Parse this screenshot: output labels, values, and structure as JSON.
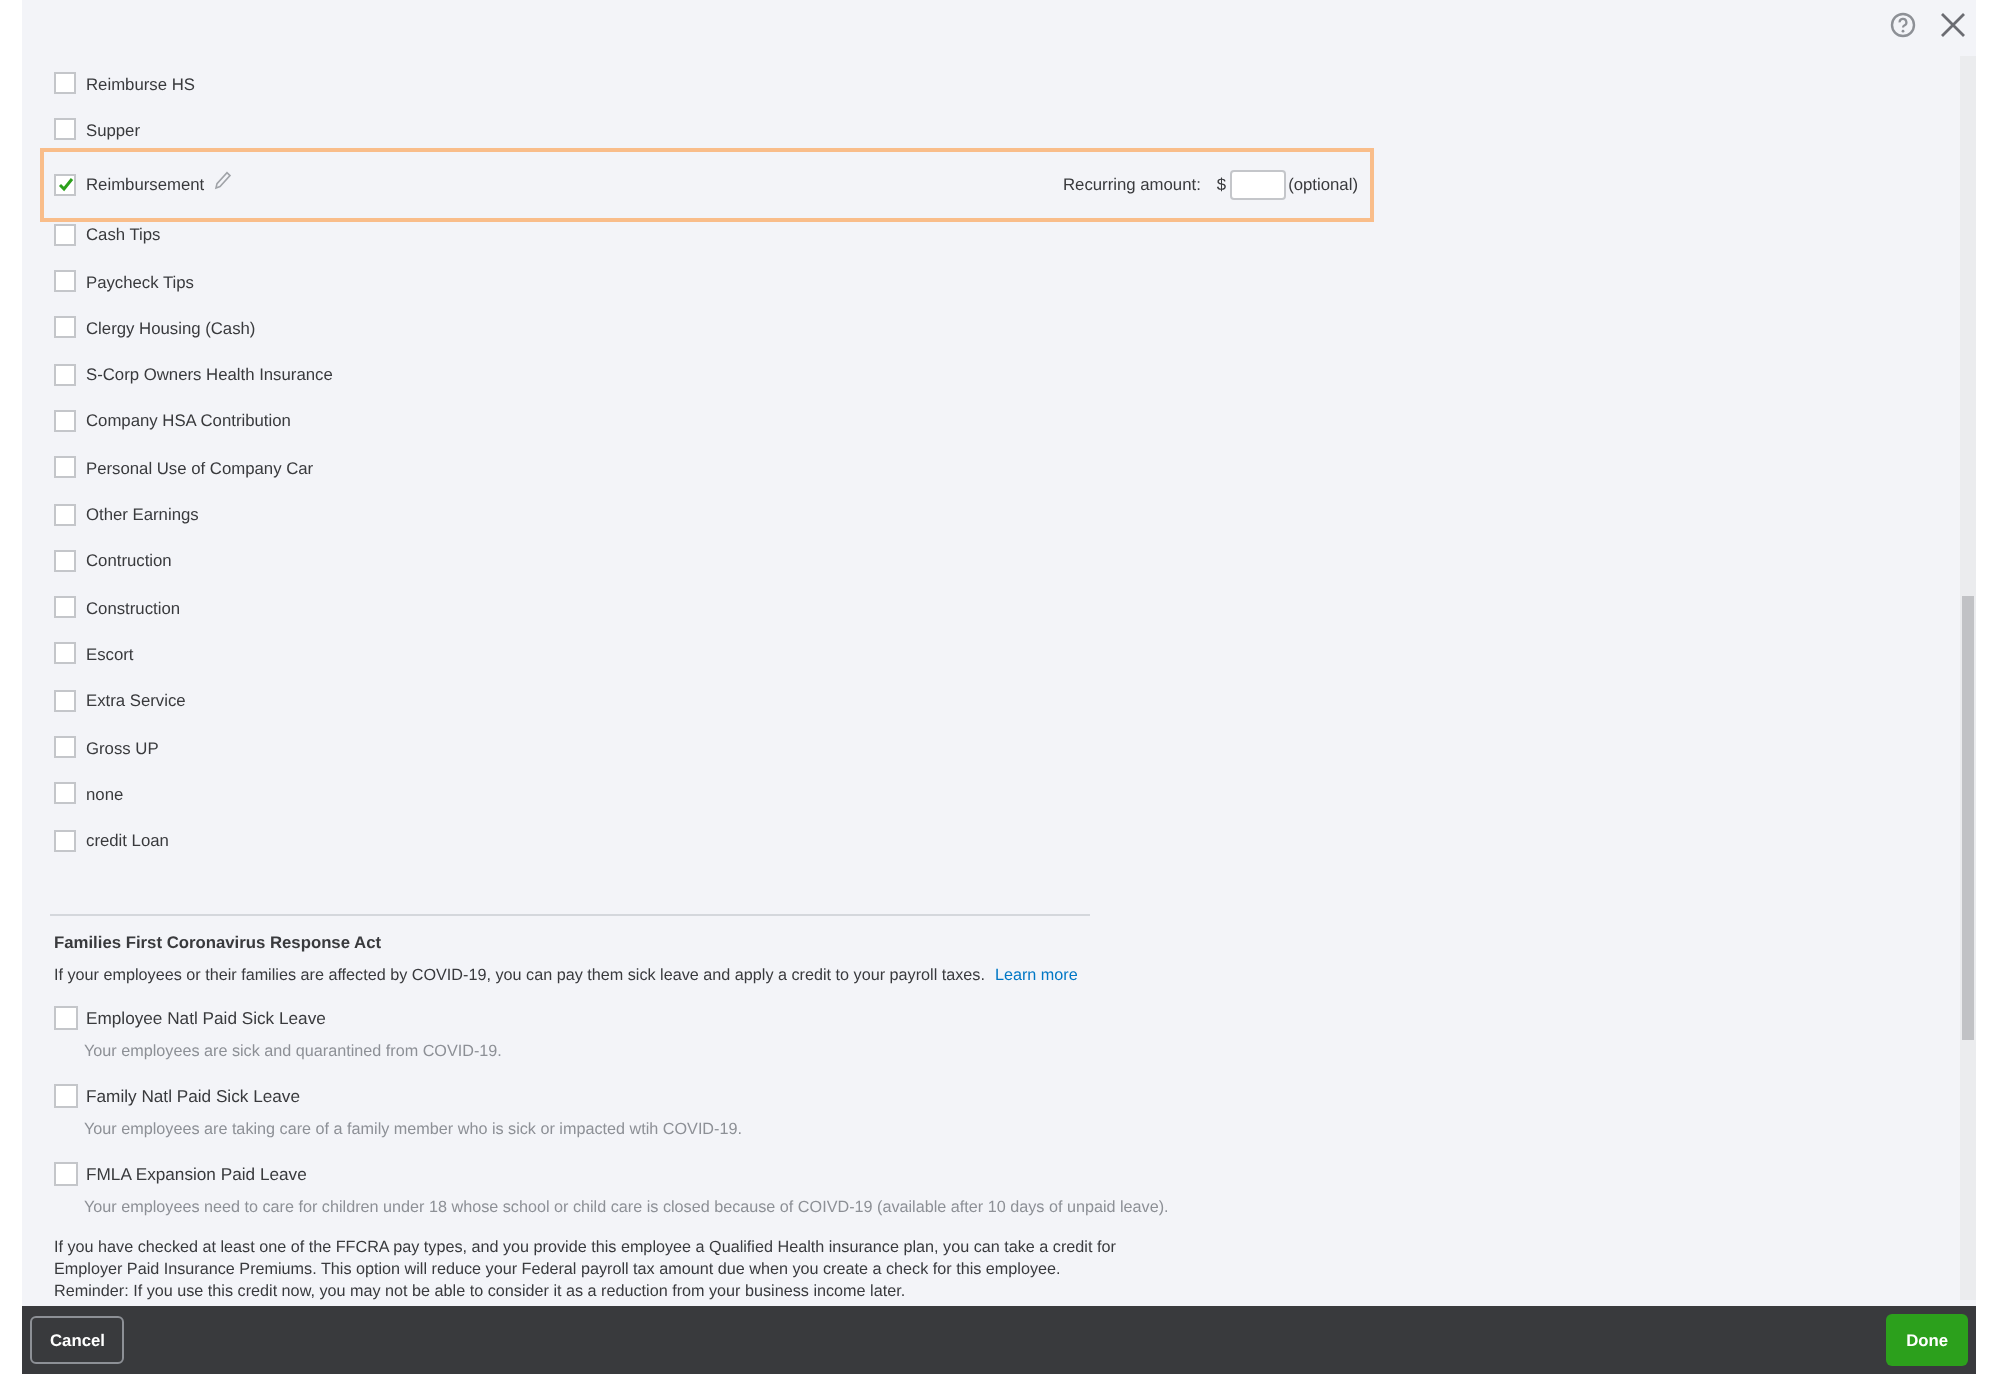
{
  "pay_types": [
    {
      "label": "Reimburse HS",
      "checked": false
    },
    {
      "label": "Supper",
      "checked": false
    },
    {
      "label": "Reimbursement",
      "checked": true,
      "kind": "amount",
      "amount_label": "Recurring amount:",
      "currency": "$",
      "hint": "(optional)"
    },
    {
      "label": "Cash Tips",
      "checked": false
    },
    {
      "label": "Paycheck Tips",
      "checked": false
    },
    {
      "label": "Clergy Housing (Cash)",
      "checked": false
    },
    {
      "label": "S-Corp Owners Health Insurance",
      "checked": false
    },
    {
      "label": "Company HSA Contribution",
      "checked": false
    },
    {
      "label": "Personal Use of Company Car",
      "checked": false
    },
    {
      "label": "Other Earnings",
      "checked": false
    },
    {
      "label": "Contruction",
      "checked": false
    },
    {
      "label": "Construction",
      "checked": false
    },
    {
      "label": "Escort",
      "checked": false
    },
    {
      "label": "Extra Service",
      "checked": false
    },
    {
      "label": "Gross UP",
      "checked": false
    },
    {
      "label": "none",
      "checked": false
    },
    {
      "label": "credit Loan",
      "checked": false
    }
  ],
  "ffcra": {
    "title": "Families First Coronavirus Response Act",
    "intro": "If your employees or their families are affected by COVID-19, you can pay them sick leave and apply a credit to your payroll taxes.",
    "link": "Learn more",
    "items": [
      {
        "label": "Employee Natl Paid Sick Leave",
        "description": "Your employees are sick and quarantined from COVID-19.",
        "checked": false
      },
      {
        "label": "Family Natl Paid Sick Leave",
        "description": "Your employees are taking care of a family member who is sick or impacted wtih COVID-19.",
        "checked": false
      },
      {
        "label": "FMLA Expansion Paid Leave",
        "description": "Your employees need to care for children under 18 whose school or child care is closed because of COIVD-19 (available after 10 days of unpaid leave).",
        "checked": false
      }
    ],
    "note": [
      "If you have checked at least one of the FFCRA pay types, and you provide this employee a Qualified Health insurance plan, you can take a credit for",
      "Employer Paid Insurance Premiums. This option will reduce your Federal payroll tax amount due when you create a check for this employee.",
      "Reminder: If you use this credit now, you may not be able to consider it as a reduction from your business income later."
    ]
  },
  "footer": {
    "cancel": "Cancel",
    "done": "Done"
  }
}
